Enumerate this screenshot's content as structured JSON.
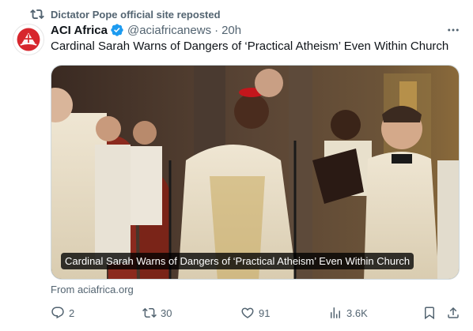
{
  "repost": {
    "text": "Dictator Pope official site reposted",
    "icon": "repost-icon"
  },
  "author": {
    "name": "ACI Africa",
    "handle": "@aciafricanews",
    "separator": "·",
    "time": "20h",
    "verified_color": "#1d9bf0",
    "avatar_color": "#d7262d"
  },
  "tweet": {
    "text": "Cardinal Sarah Warns of Dangers of ‘Practical Atheism’ Even Within Church"
  },
  "card": {
    "caption": "Cardinal Sarah Warns of Dangers of ‘Practical Atheism’ Even Within Church",
    "source": "From aciafrica.org"
  },
  "actions": {
    "replies": "2",
    "reposts": "30",
    "likes": "91",
    "views": "3.6K"
  },
  "colors": {
    "muted": "#536471",
    "text": "#0f1419",
    "border": "#cfd9de"
  }
}
